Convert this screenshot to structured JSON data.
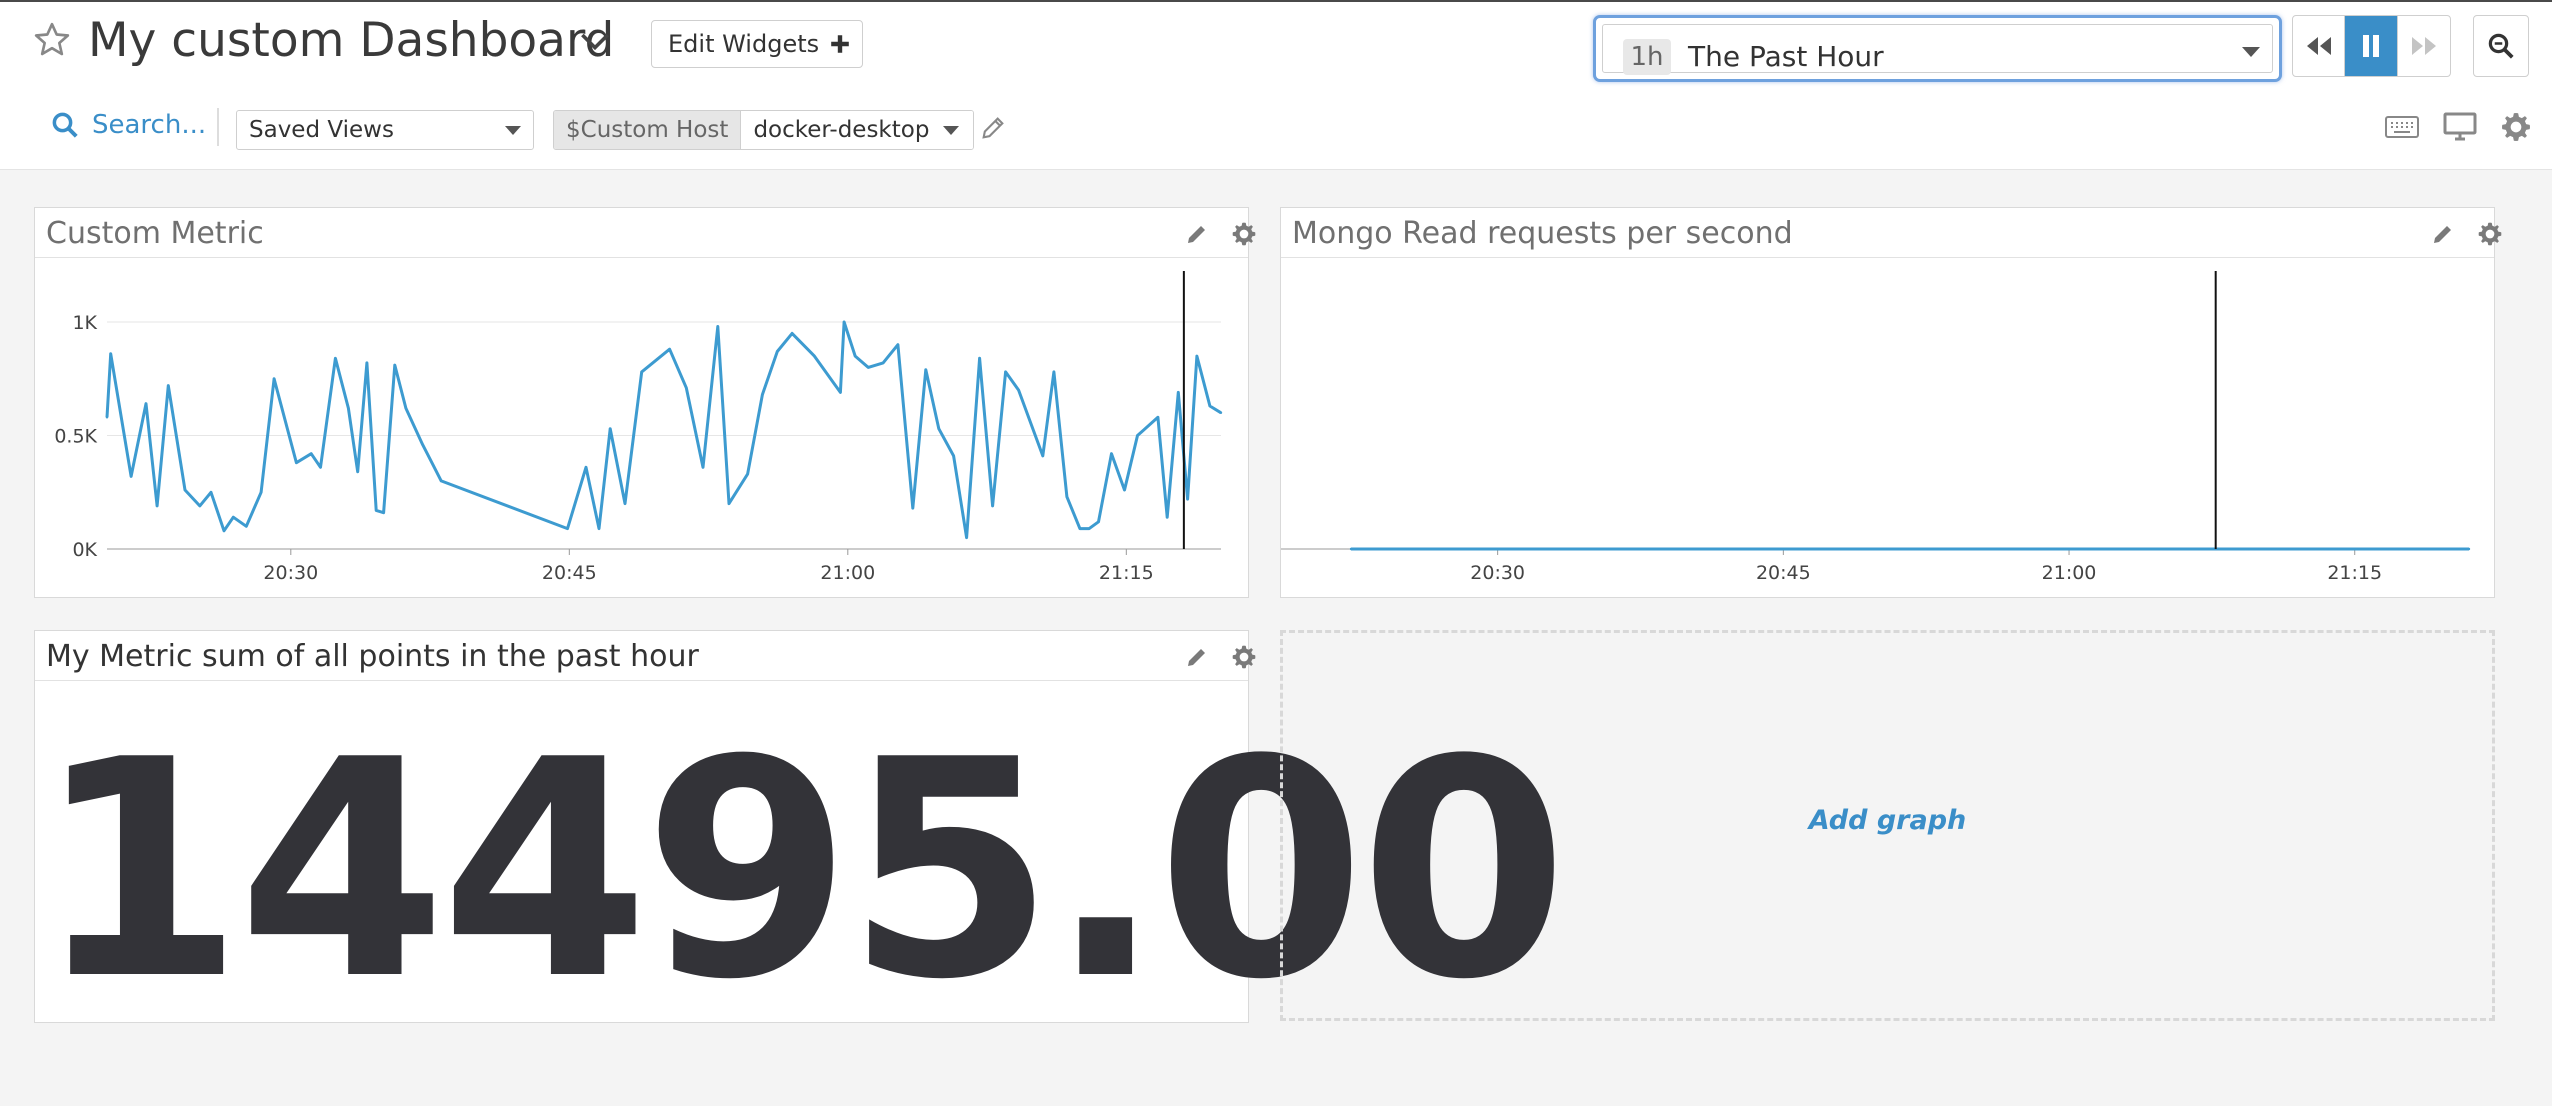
{
  "header": {
    "title": "My custom Dashboard",
    "edit_widgets_label": "Edit Widgets",
    "time_badge": "1h",
    "time_label": "The Past Hour",
    "search_label": "Search...",
    "saved_views_label": "Saved Views",
    "template_var_key": "$Custom Host",
    "template_var_value": "docker-desktop"
  },
  "icons": [
    "star-icon",
    "chevron-down-icon",
    "plus-icon",
    "caret-down-icon",
    "rewind-icon",
    "pause-icon",
    "fast-forward-icon",
    "zoom-icon",
    "search-icon",
    "pencil-icon",
    "keyboard-icon",
    "tv-icon",
    "gear-icon"
  ],
  "colors": {
    "accent": "#3a8ec8",
    "series": "#3d9bd0",
    "focus": "#6ea1de",
    "value": "#333338"
  },
  "widgets": [
    {
      "title": "Custom Metric"
    },
    {
      "title": "Mongo Read requests per second"
    },
    {
      "title": "My Metric sum of all points in the past hour",
      "value": "14495.00"
    },
    {
      "add_label": "Add graph"
    }
  ],
  "chart_data": [
    {
      "type": "line",
      "title": "Custom Metric",
      "x_ticks": [
        "20:30",
        "20:45",
        "21:00",
        "21:15"
      ],
      "x_tick_minutes": [
        30,
        45,
        60,
        75
      ],
      "xlim_minutes": [
        20.1,
        80.1
      ],
      "y_ticks": [
        "0K",
        "0.5K",
        "1K"
      ],
      "ylim": [
        0,
        1000
      ],
      "marker_minute": 78.1,
      "series": [
        {
          "x": [
            20.1,
            20.3,
            21.4,
            22.2,
            22.8,
            23.4,
            24.3,
            25.1,
            25.7,
            26.4,
            26.9,
            27.6,
            28.4,
            29.1,
            30.3,
            31.1,
            31.6,
            32.4,
            33.1,
            33.6,
            34.1,
            34.6,
            35.0,
            35.6,
            36.2,
            37.1,
            37.6,
            38.1,
            44.9,
            45.9,
            46.6,
            47.2,
            48.0,
            48.9,
            50.4,
            51.3,
            52.2,
            53.0,
            53.6,
            54.6,
            55.4,
            56.2,
            57.0,
            58.2,
            59.6,
            59.8,
            60.4,
            61.1,
            61.9,
            62.7,
            63.5,
            64.2,
            64.9,
            65.7,
            66.4,
            67.1,
            67.8,
            68.5,
            69.2,
            70.5,
            71.1,
            71.8,
            72.5,
            73.0,
            73.5,
            74.2,
            74.9,
            75.6,
            76.7,
            77.2,
            77.8,
            78.3,
            78.8,
            79.5,
            80.1
          ],
          "values": [
            580,
            860,
            320,
            640,
            190,
            720,
            260,
            190,
            250,
            80,
            140,
            100,
            250,
            750,
            380,
            420,
            360,
            840,
            620,
            340,
            820,
            170,
            160,
            810,
            620,
            460,
            380,
            300,
            90,
            360,
            90,
            530,
            200,
            780,
            880,
            710,
            360,
            980,
            200,
            330,
            680,
            870,
            950,
            850,
            690,
            1000,
            850,
            800,
            820,
            900,
            180,
            790,
            530,
            410,
            50,
            840,
            190,
            780,
            700,
            410,
            780,
            230,
            90,
            90,
            120,
            420,
            260,
            500,
            580,
            140,
            690,
            220,
            850,
            630,
            600
          ]
        }
      ]
    },
    {
      "type": "line",
      "title": "Mongo Read requests per second",
      "x_ticks": [
        "20:30",
        "20:45",
        "21:00",
        "21:15"
      ],
      "x_tick_minutes": [
        30,
        45,
        60,
        75
      ],
      "xlim_minutes": [
        22.3,
        81.0
      ],
      "ylim": [
        0,
        1
      ],
      "marker_minute": 67.7,
      "series": [
        {
          "x": [
            22.3,
            81.0
          ],
          "values": [
            0,
            0
          ]
        }
      ]
    }
  ]
}
